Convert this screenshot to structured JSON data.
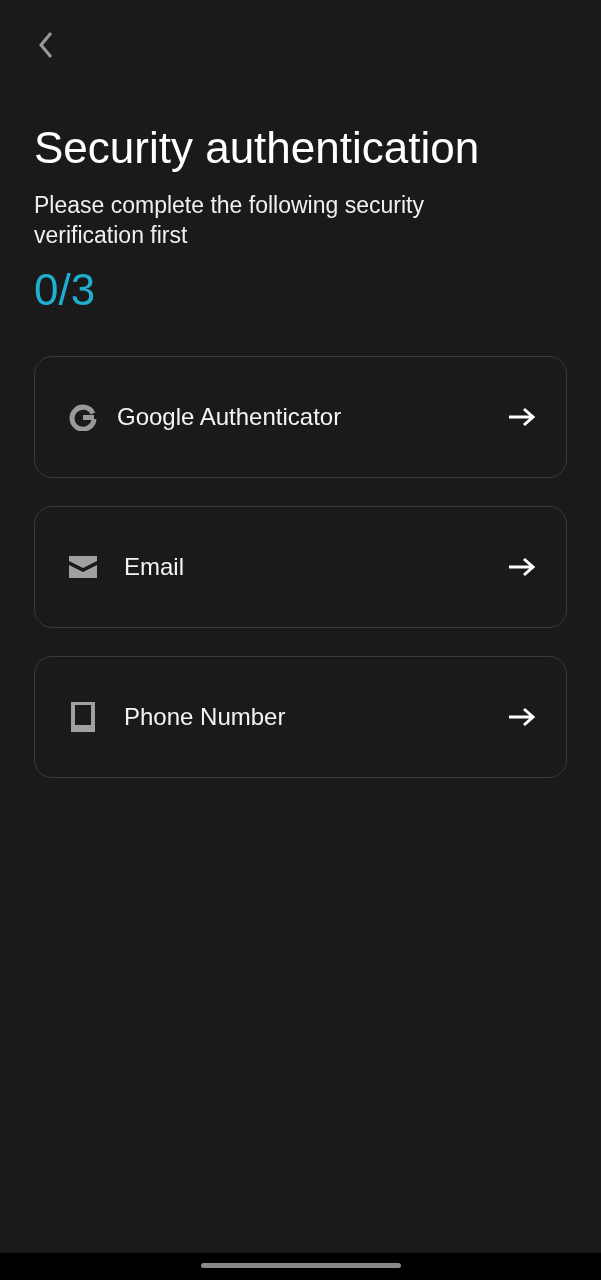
{
  "title": "Security authentication",
  "subtitle": "Please complete the following security verification first",
  "progress": "0/3",
  "methods": [
    {
      "kind": "google",
      "label": "Google Authenticator"
    },
    {
      "kind": "email",
      "label": "Email"
    },
    {
      "kind": "phone",
      "label": "Phone Number"
    }
  ]
}
